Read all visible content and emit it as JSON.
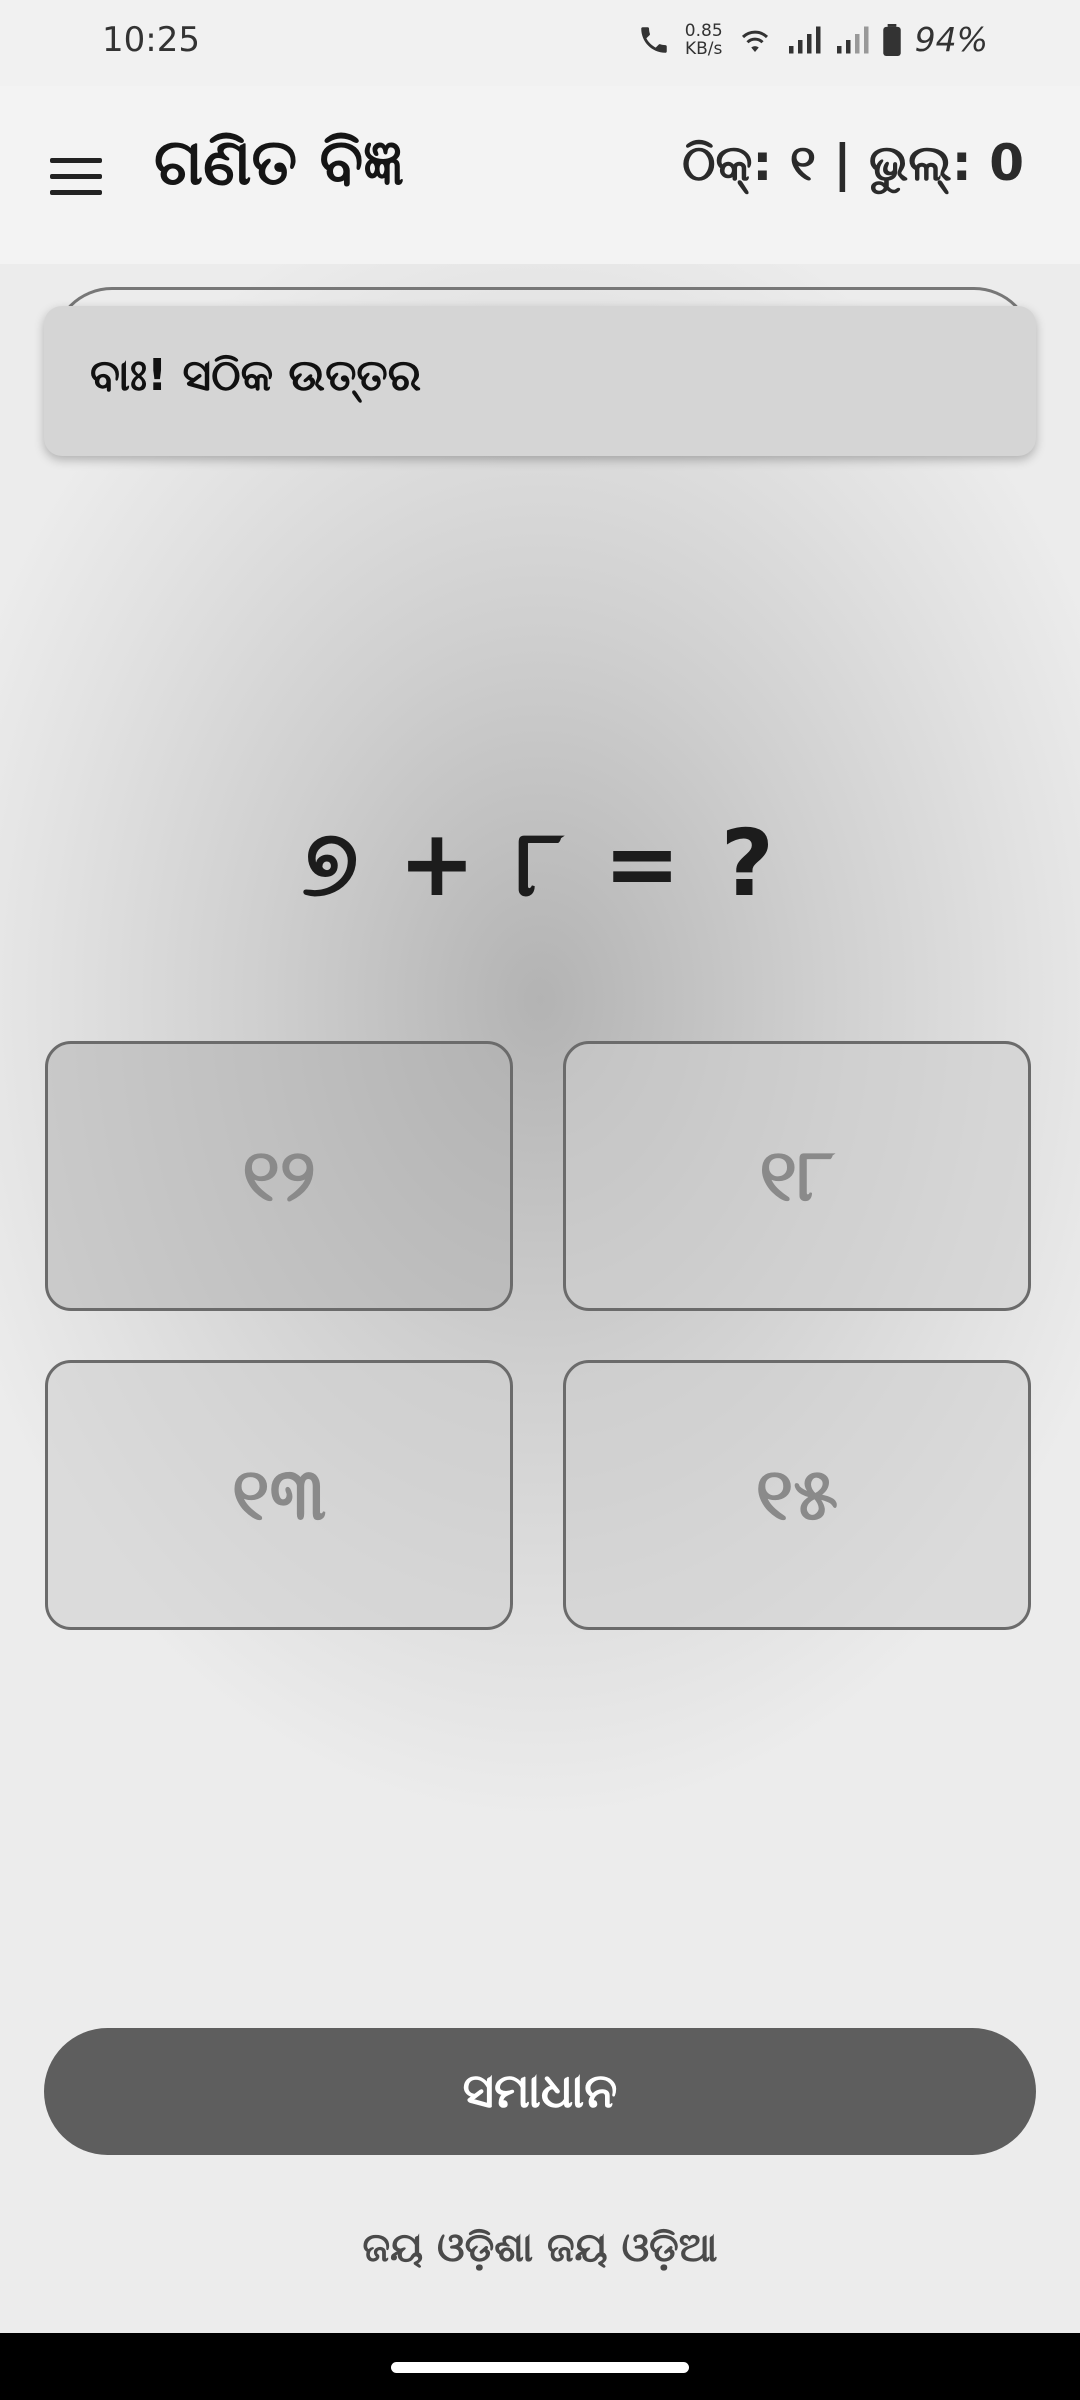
{
  "status": {
    "time": "10:25",
    "netspeed_value": "0.85",
    "netspeed_unit": "KB/s",
    "battery": "94%",
    "icons": [
      "call-icon",
      "wifi-icon",
      "signal-icon",
      "signal-icon-2",
      "battery-icon"
    ]
  },
  "app_bar": {
    "title": "ଗଣିତ ବିଜ୍ଞ",
    "score": "ଠିକ୍: ୧ | ଭୁଲ୍: 0"
  },
  "feedback": {
    "message": "ବାଃ! ସଠିକ ଉତ୍ତର"
  },
  "question": {
    "text": "୭ + ୮ = ?"
  },
  "options": [
    {
      "label": "୧୨"
    },
    {
      "label": "୧୮"
    },
    {
      "label": "୧୩"
    },
    {
      "label": "୧୫"
    }
  ],
  "solution_button": {
    "label": "ସମାଧାନ"
  },
  "footer": {
    "text": "ଜୟ ଓଡ଼ିଶା ଜୟ ଓଡ଼ିଆ"
  }
}
